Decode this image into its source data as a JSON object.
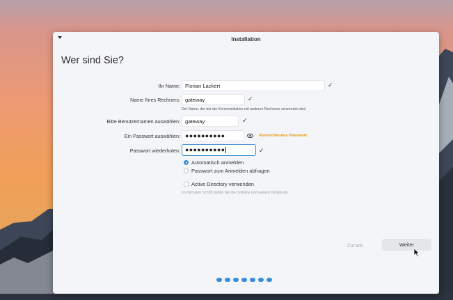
{
  "window": {
    "title": "Installation"
  },
  "page": {
    "heading": "Wer sind Sie?"
  },
  "form": {
    "name_label": "Ihr Name:",
    "name_value": "Florian Lackert",
    "computer_label": "Name Ihres Rechners:",
    "computer_value": "gateway",
    "computer_hint": "Der Name, der bei der Kommunikation mit anderen Rechnern verwendet wird.",
    "username_label": "Bitte Benutzernamen auswählen:",
    "username_value": "gateway",
    "password_label": "Ein Passwort auswählen:",
    "password_value": "●●●●●●●●●●",
    "password_strength": "Ausreichendes Passwort",
    "confirm_label": "Passwort wiederholen:",
    "confirm_value": "●●●●●●●●●●",
    "auto_login_label": "Automatisch anmelden",
    "ask_password_label": "Passwort zum Anmelden abfragen",
    "login_mode_selected": "Automatisch anmelden",
    "active_directory_label": "Active Directory verwenden",
    "active_directory_checked": false,
    "active_directory_hint": "Im nächsten Schritt geben Sie die Domäne und weitere Details ein."
  },
  "nav": {
    "back_label": "Zurück",
    "next_label": "Weiter"
  },
  "progress": {
    "total_steps": 7
  },
  "colors": {
    "accent": "#3b8fd8",
    "strength": "#e8950c",
    "window_bg": "#f4f5f8"
  },
  "icons": {
    "menu": "chevron-down-icon",
    "valid": "checkmark-icon",
    "reveal": "eye-icon",
    "pointer": "mouse-pointer-icon"
  }
}
